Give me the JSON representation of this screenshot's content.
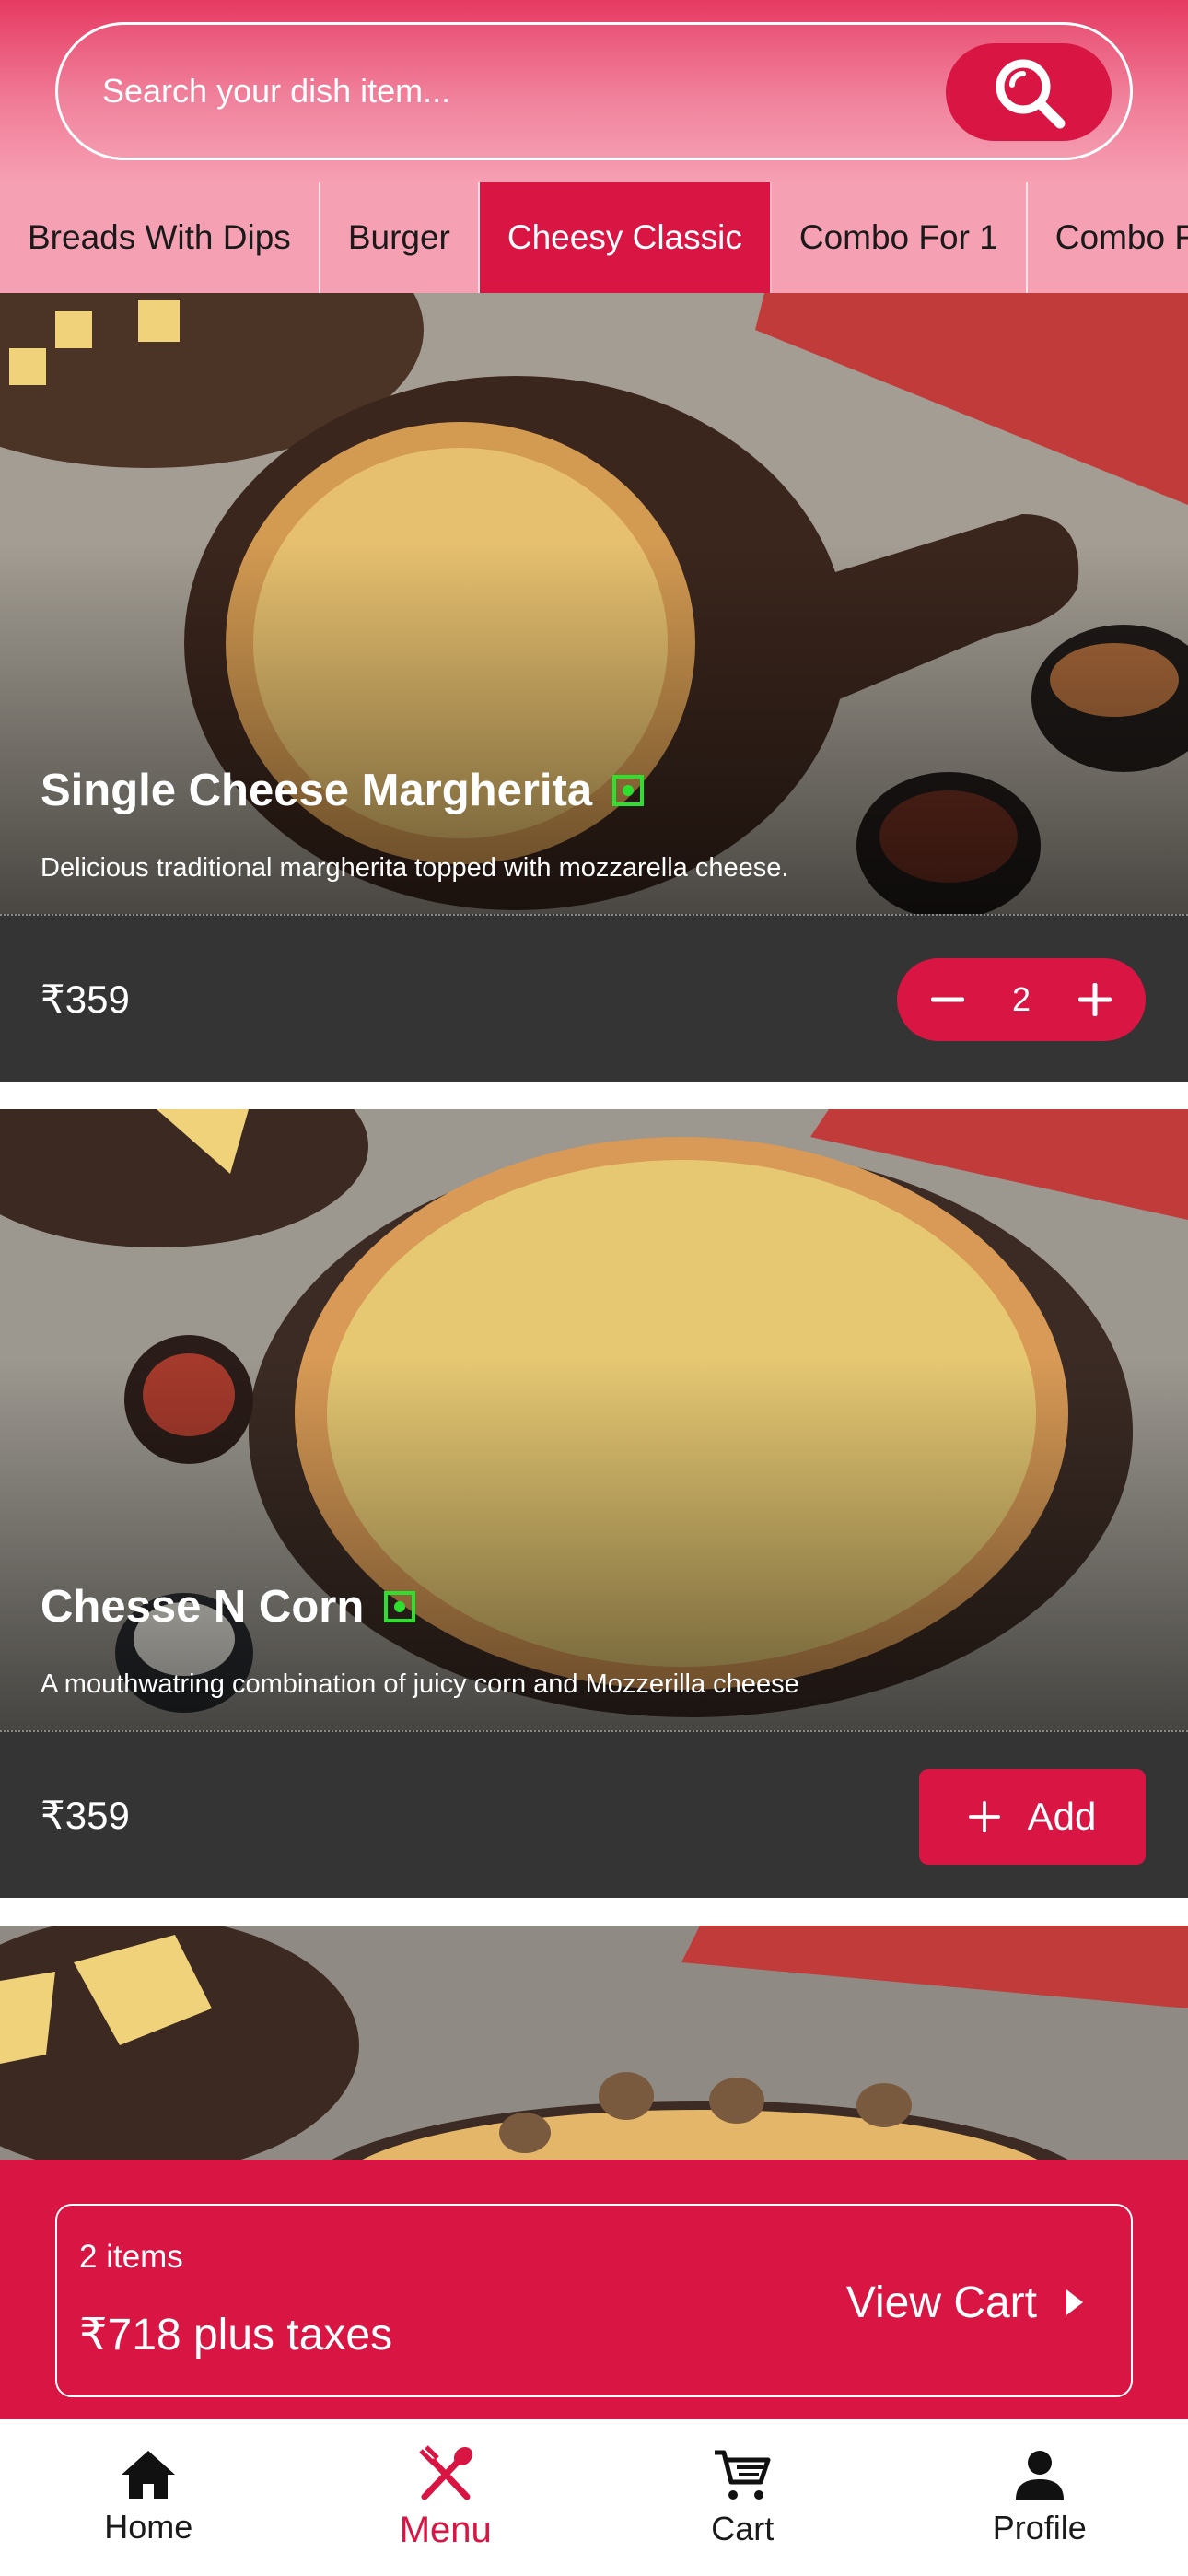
{
  "search": {
    "placeholder": "Search your dish item..."
  },
  "categories": [
    "Breads With Dips",
    "Burger",
    "Cheesy Classic",
    "Combo For 1",
    "Combo F"
  ],
  "active_category": "Cheesy Classic",
  "products": [
    {
      "title": "Single Cheese Margherita",
      "description": "Delicious traditional margherita topped with mozzarella cheese.",
      "price": "₹359",
      "quantity": "2"
    },
    {
      "title": "Chesse N Corn",
      "description": "A mouthwatring combination of juicy corn and Mozzerilla cheese",
      "price": "₹359",
      "add_label": "Add"
    }
  ],
  "cart": {
    "items_text": "2 items",
    "total_text": "₹718 plus taxes",
    "view_label": "View Cart"
  },
  "nav": [
    {
      "label": "Home",
      "icon": "home-icon"
    },
    {
      "label": "Menu",
      "icon": "fork-knife-icon"
    },
    {
      "label": "Cart",
      "icon": "cart-icon"
    },
    {
      "label": "Profile",
      "icon": "person-icon"
    }
  ],
  "colors": {
    "accent": "#d81543",
    "dark_bar": "#343434",
    "veg_mark": "#2ee02e"
  }
}
